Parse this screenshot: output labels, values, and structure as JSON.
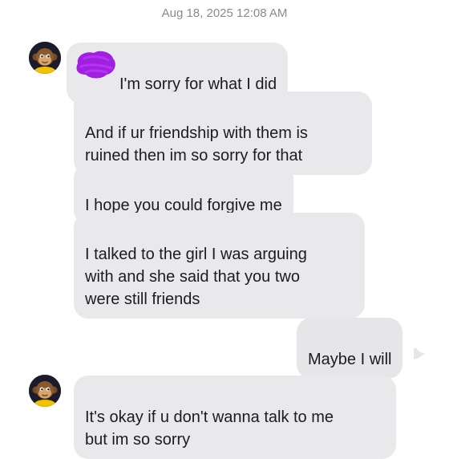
{
  "conversation": {
    "timestamp": "Aug 18, 2025 12:08 AM",
    "messages": [
      {
        "sender": "contact",
        "text": "I'm sorry for what I did",
        "redacted_prefix": true
      },
      {
        "sender": "contact",
        "text": "And if ur friendship with them is\nruined then im so sorry for that"
      },
      {
        "sender": "contact",
        "text": "I hope you could forgive me"
      },
      {
        "sender": "contact",
        "text": "I talked to the girl I was arguing\nwith and she said that you two\nwere still friends"
      },
      {
        "sender": "me",
        "text": "Maybe I will"
      },
      {
        "sender": "contact",
        "text": "It's okay if u don't wanna talk to me\nbut im so sorry"
      }
    ]
  },
  "avatar": {
    "icon": "monkey-avatar-icon"
  },
  "colors": {
    "incoming_bubble": "#e9e9eb",
    "outgoing_bubble": "#e6e6e8",
    "timestamp": "#8a8a8e",
    "redaction": "#a11fe0"
  }
}
